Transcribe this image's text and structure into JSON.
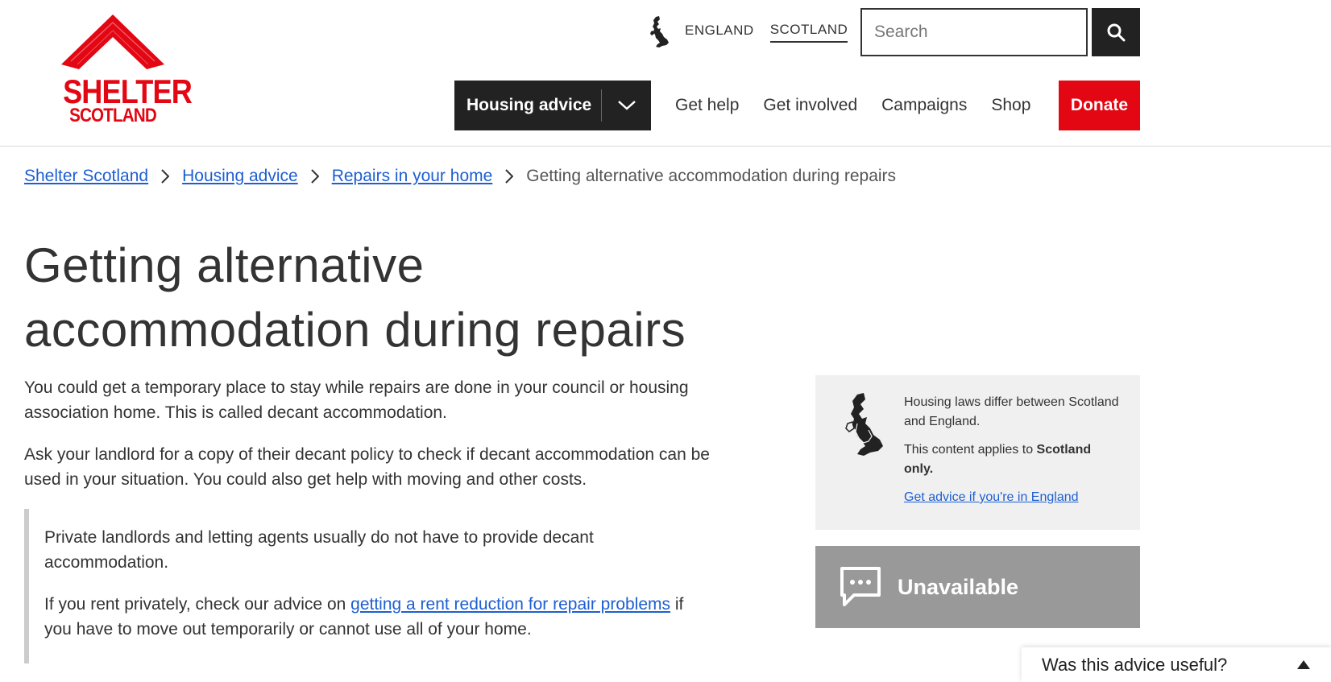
{
  "logo": {
    "line1": "SHELTER",
    "line2": "SCOTLAND",
    "color": "#e30613"
  },
  "region_switch": {
    "icon": "uk-map-icon",
    "england": "ENGLAND",
    "scotland": "SCOTLAND",
    "active": "scotland"
  },
  "search": {
    "placeholder": "Search",
    "value": "",
    "icon": "search-icon"
  },
  "nav": {
    "primary_label": "Housing advice",
    "primary_icon": "chevron-down-icon",
    "links": [
      "Get help",
      "Get involved",
      "Campaigns",
      "Shop"
    ],
    "donate": "Donate",
    "donate_color": "#e30613"
  },
  "breadcrumb": {
    "items": [
      "Shelter Scotland",
      "Housing advice",
      "Repairs in your home"
    ],
    "current": "Getting alternative accommodation during repairs"
  },
  "page": {
    "title": "Getting alternative accommodation during repairs",
    "paragraphs": [
      "You could get a temporary place to stay while repairs are done in your council or housing association home. This is called decant accommodation.",
      "Ask your landlord for a copy of their decant policy to check if decant accommodation can be used in your situation. You could also get help with moving and other costs."
    ],
    "callout": {
      "p1": "Private landlords and letting agents usually do not have to provide decant accommodation.",
      "p2_before": "If you rent privately, check our advice on ",
      "p2_link": "getting a rent reduction for repair problems",
      "p2_after": " if you have to move out temporarily or cannot use all of your home."
    }
  },
  "region_panel": {
    "line1": "Housing laws differ between Scotland and England.",
    "line2_prefix": "This content applies to ",
    "line2_bold": "Scotland only.",
    "link": "Get advice if you're in England"
  },
  "chat": {
    "icon": "chat-bubble-icon",
    "label": "Unavailable"
  },
  "feedback": {
    "label": "Was this advice useful?",
    "icon": "caret-up-icon"
  },
  "colors": {
    "link": "#1d5fd1",
    "dark": "#222222",
    "panel_bg": "#f0f0f0",
    "chat_bg": "#999999"
  }
}
